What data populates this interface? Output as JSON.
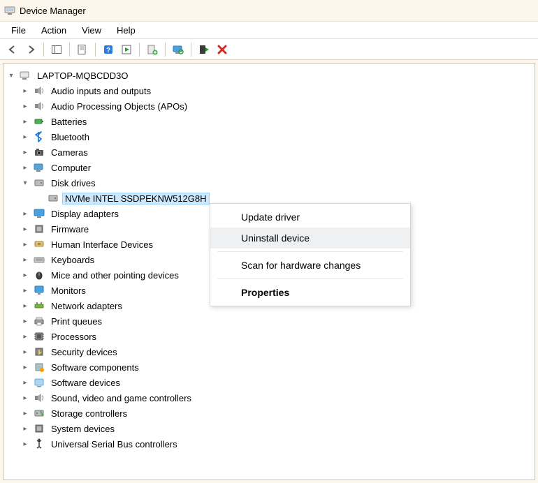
{
  "window": {
    "title": "Device Manager"
  },
  "menu": {
    "file": "File",
    "action": "Action",
    "view": "View",
    "help": "Help"
  },
  "tree": {
    "root": "LAPTOP-MQBCDD3O",
    "categories": [
      {
        "label": "Audio inputs and outputs",
        "icon": "speaker"
      },
      {
        "label": "Audio Processing Objects (APOs)",
        "icon": "speaker"
      },
      {
        "label": "Batteries",
        "icon": "battery"
      },
      {
        "label": "Bluetooth",
        "icon": "bluetooth"
      },
      {
        "label": "Cameras",
        "icon": "camera"
      },
      {
        "label": "Computer",
        "icon": "computer"
      },
      {
        "label": "Disk drives",
        "icon": "disk",
        "expanded": true,
        "children": [
          {
            "label": "NVMe INTEL SSDPEKNW512G8H",
            "icon": "disk",
            "selected": true
          }
        ]
      },
      {
        "label": "Display adapters",
        "icon": "display"
      },
      {
        "label": "Firmware",
        "icon": "chip"
      },
      {
        "label": "Human Interface Devices",
        "icon": "hid"
      },
      {
        "label": "Keyboards",
        "icon": "keyboard"
      },
      {
        "label": "Mice and other pointing devices",
        "icon": "mouse"
      },
      {
        "label": "Monitors",
        "icon": "monitor"
      },
      {
        "label": "Network adapters",
        "icon": "network"
      },
      {
        "label": "Print queues",
        "icon": "printer"
      },
      {
        "label": "Processors",
        "icon": "cpu"
      },
      {
        "label": "Security devices",
        "icon": "security"
      },
      {
        "label": "Software components",
        "icon": "swcomp"
      },
      {
        "label": "Software devices",
        "icon": "swdev"
      },
      {
        "label": "Sound, video and game controllers",
        "icon": "sound"
      },
      {
        "label": "Storage controllers",
        "icon": "storage"
      },
      {
        "label": "System devices",
        "icon": "system"
      },
      {
        "label": "Universal Serial Bus controllers",
        "icon": "usb"
      }
    ]
  },
  "context_menu": {
    "update": "Update driver",
    "uninstall": "Uninstall device",
    "scan": "Scan for hardware changes",
    "properties": "Properties"
  }
}
